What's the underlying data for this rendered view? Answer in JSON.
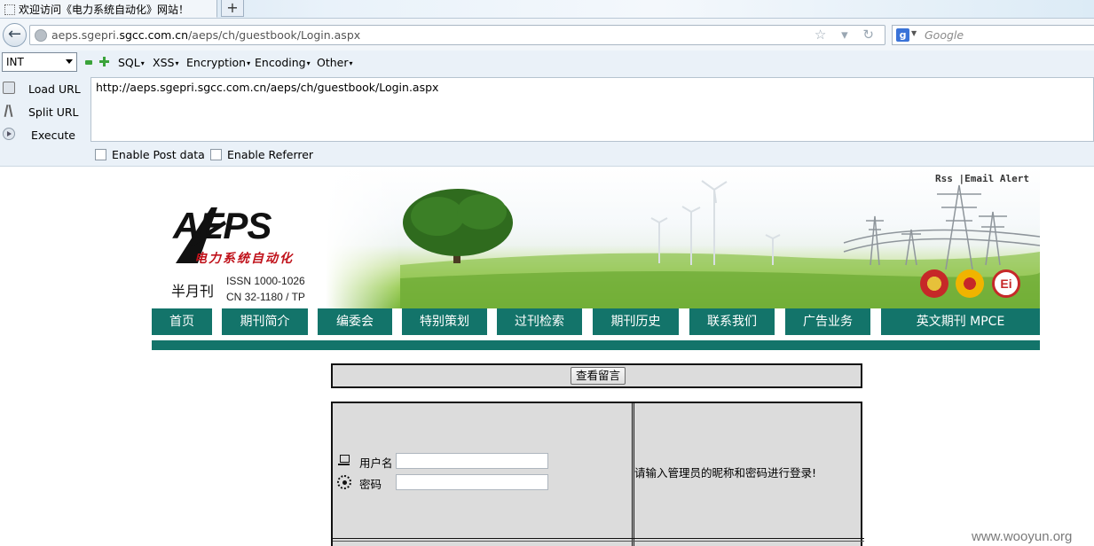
{
  "browser": {
    "tab_title": "欢迎访问《电力系统自动化》网站！",
    "new_tab": "+",
    "url_domain": "aeps.sgepri.sgcc.com.cn",
    "url_pre": "aeps.sgepri.",
    "url_dom": "sgcc.com.cn",
    "url_path": "/aeps/ch/guestbook/Login.aspx",
    "url_ctrls": "☆ ▾ ↻",
    "search_placeholder": "Google"
  },
  "hackbar": {
    "select_value": "INT",
    "menus": [
      "SQL",
      "XSS",
      "Encryption",
      "Encoding",
      "Other"
    ],
    "actions": [
      "Load URL",
      "Split URL",
      "Execute"
    ],
    "url_text": "http://aeps.sgepri.sgcc.com.cn/aeps/ch/guestbook/Login.aspx",
    "checkboxes": [
      "Enable Post data",
      "Enable Referrer"
    ]
  },
  "header": {
    "top_links": "Rss  |Email Alert",
    "logo_text": "AEPS",
    "logo_cn": "电力系统自动化",
    "semimonthly": "半月刊",
    "issn": "ISSN 1000-1026",
    "cn": "CN 32-1180 / TP",
    "badge_ei": "Ei"
  },
  "nav": [
    "首页",
    "期刊简介",
    "编委会",
    "特别策划",
    "过刊检索",
    "期刊历史",
    "联系我们",
    "广告业务",
    "英文期刊 MPCE"
  ],
  "guestbook": {
    "view_button": "查看留言",
    "username_label": "用户名",
    "password_label": "密码",
    "hint": "请输入管理员的昵称和密码进行登录!"
  },
  "watermark": "www.wooyun.org",
  "colors": {
    "nav_green": "#13746a",
    "box_gray": "#dcdcdc"
  }
}
